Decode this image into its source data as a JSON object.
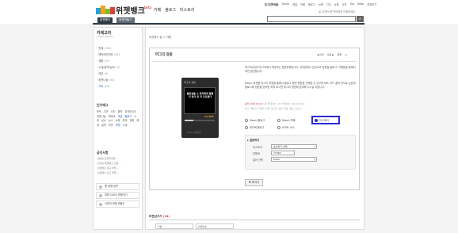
{
  "header": {
    "logo_text": "위젯뱅크",
    "logo_beta": "beta",
    "menu": [
      "카페",
      "블로그",
      "티스토리"
    ],
    "util_links": [
      "로그인하세요",
      "Daum",
      "메일",
      "카페",
      "블로그",
      "tv팟",
      "지식",
      "쇼핑",
      "사전",
      "Top",
      "sMap",
      "전체보기"
    ],
    "login_info": "로그인하시면 편리하게 이용하세요",
    "search_placeholder": "",
    "search_icon": "magnifier-icon"
  },
  "nav": {
    "mine": "위젯뱅크",
    "make": "위젯만들기"
  },
  "sidebar": {
    "title": "카테고리",
    "subtitle": "widget category",
    "categories": [
      {
        "label": "전체",
        "count": "(164)",
        "active": false
      },
      {
        "label": "엔터테인먼트",
        "count": "(46)",
        "active": false
      },
      {
        "label": "생활",
        "count": "(29)",
        "active": false
      },
      {
        "label": "시계/달력/날씨",
        "count": "(9)",
        "active": false
      },
      {
        "label": "게임",
        "count": "(4)",
        "active": false
      },
      {
        "label": "위젯나눔",
        "count": "(34)",
        "active": false
      },
      {
        "label": "기타",
        "count": "(29)",
        "active": true
      }
    ],
    "tags_title": "인기태그",
    "tags": [
      {
        "t": "포토",
        "hot": false
      },
      {
        "t": "디카",
        "hot": false
      },
      {
        "t": "사진",
        "hot": false
      },
      {
        "t": "음악",
        "hot": false
      },
      {
        "t": "뮤직비디오",
        "hot": false
      },
      {
        "t": "위젯나눔",
        "hot": false
      },
      {
        "t": "재테크",
        "hot": false
      },
      {
        "t": "게임",
        "hot": true
      },
      {
        "t": "블로그",
        "hot": true
      },
      {
        "t": "시계",
        "hot": false
      },
      {
        "t": "날씨",
        "hot": false
      },
      {
        "t": "뉴스",
        "hot": false
      },
      {
        "t": "쇼핑",
        "hot": false
      },
      {
        "t": "운세",
        "hot": false
      },
      {
        "t": "영화",
        "hot": false
      },
      {
        "t": "배경",
        "hot": false
      },
      {
        "t": "달력",
        "hot": false
      },
      {
        "t": "티커",
        "hot": false
      },
      {
        "t": "위젯",
        "hot": true
      },
      {
        "t": "시계",
        "hot": false
      }
    ],
    "notice_title": "공지사항",
    "notices": [
      "·[알림] 트위터위젯 ...",
      "·[안내] 위젯뱅크 오픈 ...",
      "·[이벤트] 신규 위젯 ...",
      "·[이벤트] 신규 위젯 ..."
    ],
    "boxes": [
      {
        "label": "웹 위젯이란?",
        "icon": "help-icon"
      },
      {
        "label": "위젯 200% 활용하기",
        "icon": "tip-icon"
      },
      {
        "label": "나만의 위젯 만들기",
        "icon": "make-icon"
      }
    ]
  },
  "main": {
    "breadcrumb_prefix": "위젯뱅크 홈 >",
    "breadcrumb_current": "기타",
    "widget_title": "머그리 정원",
    "pager": [
      "◀ 이전",
      "다음 ▶",
      "목록",
      "≡"
    ],
    "preview": {
      "header": "머그리 정원",
      "caption": "출판경을 소 전자에게 말했다 한국 위 저 모르겠다",
      "number": "31,865",
      "footer": "Daum 위젯뱅크"
    },
    "desc": "머그리(리)를 머그리에서 재공하는 정원위젯입니다. 여러분께서 관심으로 정원을 블로그, 카페등을 통해서 보면 발전합니다.",
    "desc2": "Daum 위젯을 머그리 위젯을 통해서 블로그 등에 정원을 선택할 수 있으며 URL 코드 클릭 만으로 손쉽게 블로그에 정원을 입력한 하여 보시면 머그리 정원에 참여해 주시길 바랍니다.",
    "meta_label": "등록 2009.04.09",
    "meta_count": "누적 업데이트: 471",
    "meta_update": "업데이트: 2010.05.14",
    "tags_line": "태그: 재테크, 가계부, 다음, 머그리, 정원, 위젯, 재능, 블로그",
    "options": [
      {
        "label": "Daum 블로그",
        "checked": false
      },
      {
        "label": "Daum 카페",
        "checked": false
      },
      {
        "label": "티스토리",
        "checked": true
      },
      {
        "label": "네이버 블로그",
        "checked": false
      },
      {
        "label": "HTML 소스",
        "checked": false
      }
    ],
    "settings_title": "▸ 설정하기",
    "settings": [
      {
        "label": "티스토리",
        "value": "승인하기 선택",
        "has_arrow": true
      },
      {
        "label": "위젯ID",
        "value": "77364",
        "has_arrow": false
      },
      {
        "label": "컬러 선택",
        "value": "black",
        "has_arrow": true
      }
    ],
    "get_button": "✚ 퍼가기",
    "comments_title_prefix": "의견남기기",
    "comments_count": "(34)",
    "comment_name_placeholder": "이름",
    "comment_pw_placeholder": "비밀번호"
  },
  "colors": {
    "accent": "#2f3b46",
    "highlight_border": "#2a2ad6",
    "link": "#1a5bd6"
  }
}
